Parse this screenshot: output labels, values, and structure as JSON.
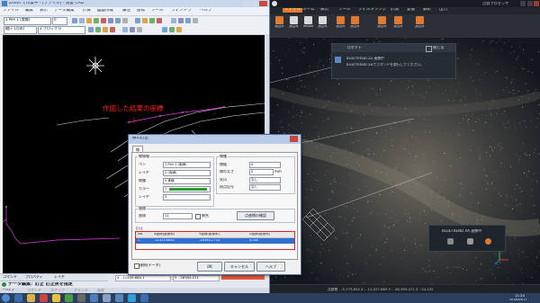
{
  "cad": {
    "title": "Zoom で作業中 - [ファイル] - 測量 CAD",
    "menu": [
      "ファイル",
      "編集",
      "表示",
      "データ編集",
      "計算",
      "図面作成",
      "属性",
      "座標",
      "ツール",
      "ウィンドウ",
      "ヘルプ"
    ],
    "toolbar1_combo1": "1 Pen 1 (実線)",
    "toolbar1_combo2": "0",
    "toolbar2_combo1": "縮尺 1/500",
    "toolbar2_combo2": "2 ブロック 0",
    "annotation": "作図した結果の座標",
    "command_tabs": [
      "コマンド",
      "プロパティ",
      "レイヤ"
    ],
    "status_line": "データ編集：訂正 訂正点を指定",
    "status_tabs": [
      "ヘルプ",
      "コマンド",
      "スナップ",
      "グリッド",
      "直交"
    ],
    "coords": [
      "X",
      "Y"
    ],
    "coord_values": [
      "-11525.684,1",
      "-28394.271"
    ]
  },
  "dialog": {
    "title": "線の訂正",
    "tab": "線",
    "group_left": "線情報",
    "group_right": "線種",
    "labels_left": [
      "ペン",
      "レイヤ",
      "線種",
      "カラー",
      "レイヤ"
    ],
    "values_left": [
      "1 Pen 1 (実線)",
      "2 (仮線)",
      "0 実線",
      "1",
      "3"
    ],
    "labels_right": [
      "線幅",
      "線の太さ",
      "矢印",
      "始点記号"
    ],
    "values_right": [
      "0",
      "0",
      "なし",
      "なし"
    ],
    "unit": "mm",
    "group_coord": "座標",
    "coord_label": "座標",
    "coord_value": "11",
    "check_label": "閉合",
    "point_button": "点座標の確認",
    "table_headers": [
      "No.",
      "X座標(座標系)",
      "Y座標(座標系)",
      "Z座標(座標系)"
    ],
    "table_row": [
      "1",
      "-11525.6841",
      "-28394.2714",
      "0.000"
    ],
    "ok": "OK",
    "cancel": "キャンセル",
    "help": "ヘルプ",
    "bottom_check": "連続(データ)",
    "selected_value": "訂正"
  },
  "pc": {
    "title": "点群プロセッサ",
    "ribbon_tabs": [
      "ファイル",
      "ホーム",
      "表示",
      "ツール",
      "フィルタリング",
      "計測",
      "変換",
      "解析",
      "出力"
    ],
    "ribbon_buttons": [
      "読込み",
      "読込み",
      "Reload",
      "読込み",
      "読込み",
      "読込み",
      "読込み",
      "読込み",
      "読込み"
    ],
    "popup_title": "コネクト",
    "popup_close": "閉じる",
    "popup_app": "BLUETREND XA 連携中",
    "popup_msg": "BLUETREND XAでコマンドを実行してください。",
    "mini_panel_title": "BLUETREND XA 連携中",
    "status_text": "点群数 : -5,773,654  X : -11,527.863  Y : -28,395.471  Z : 24.132"
  },
  "taskbar": {
    "time": "11:24",
    "date": "2016/05/11"
  },
  "colors": {
    "cad_bg": "#000000",
    "annotation": "#ff2020",
    "magenta": "#e040e0",
    "highlight": "#e02020",
    "ribbon_icon": "#e07a2e"
  }
}
